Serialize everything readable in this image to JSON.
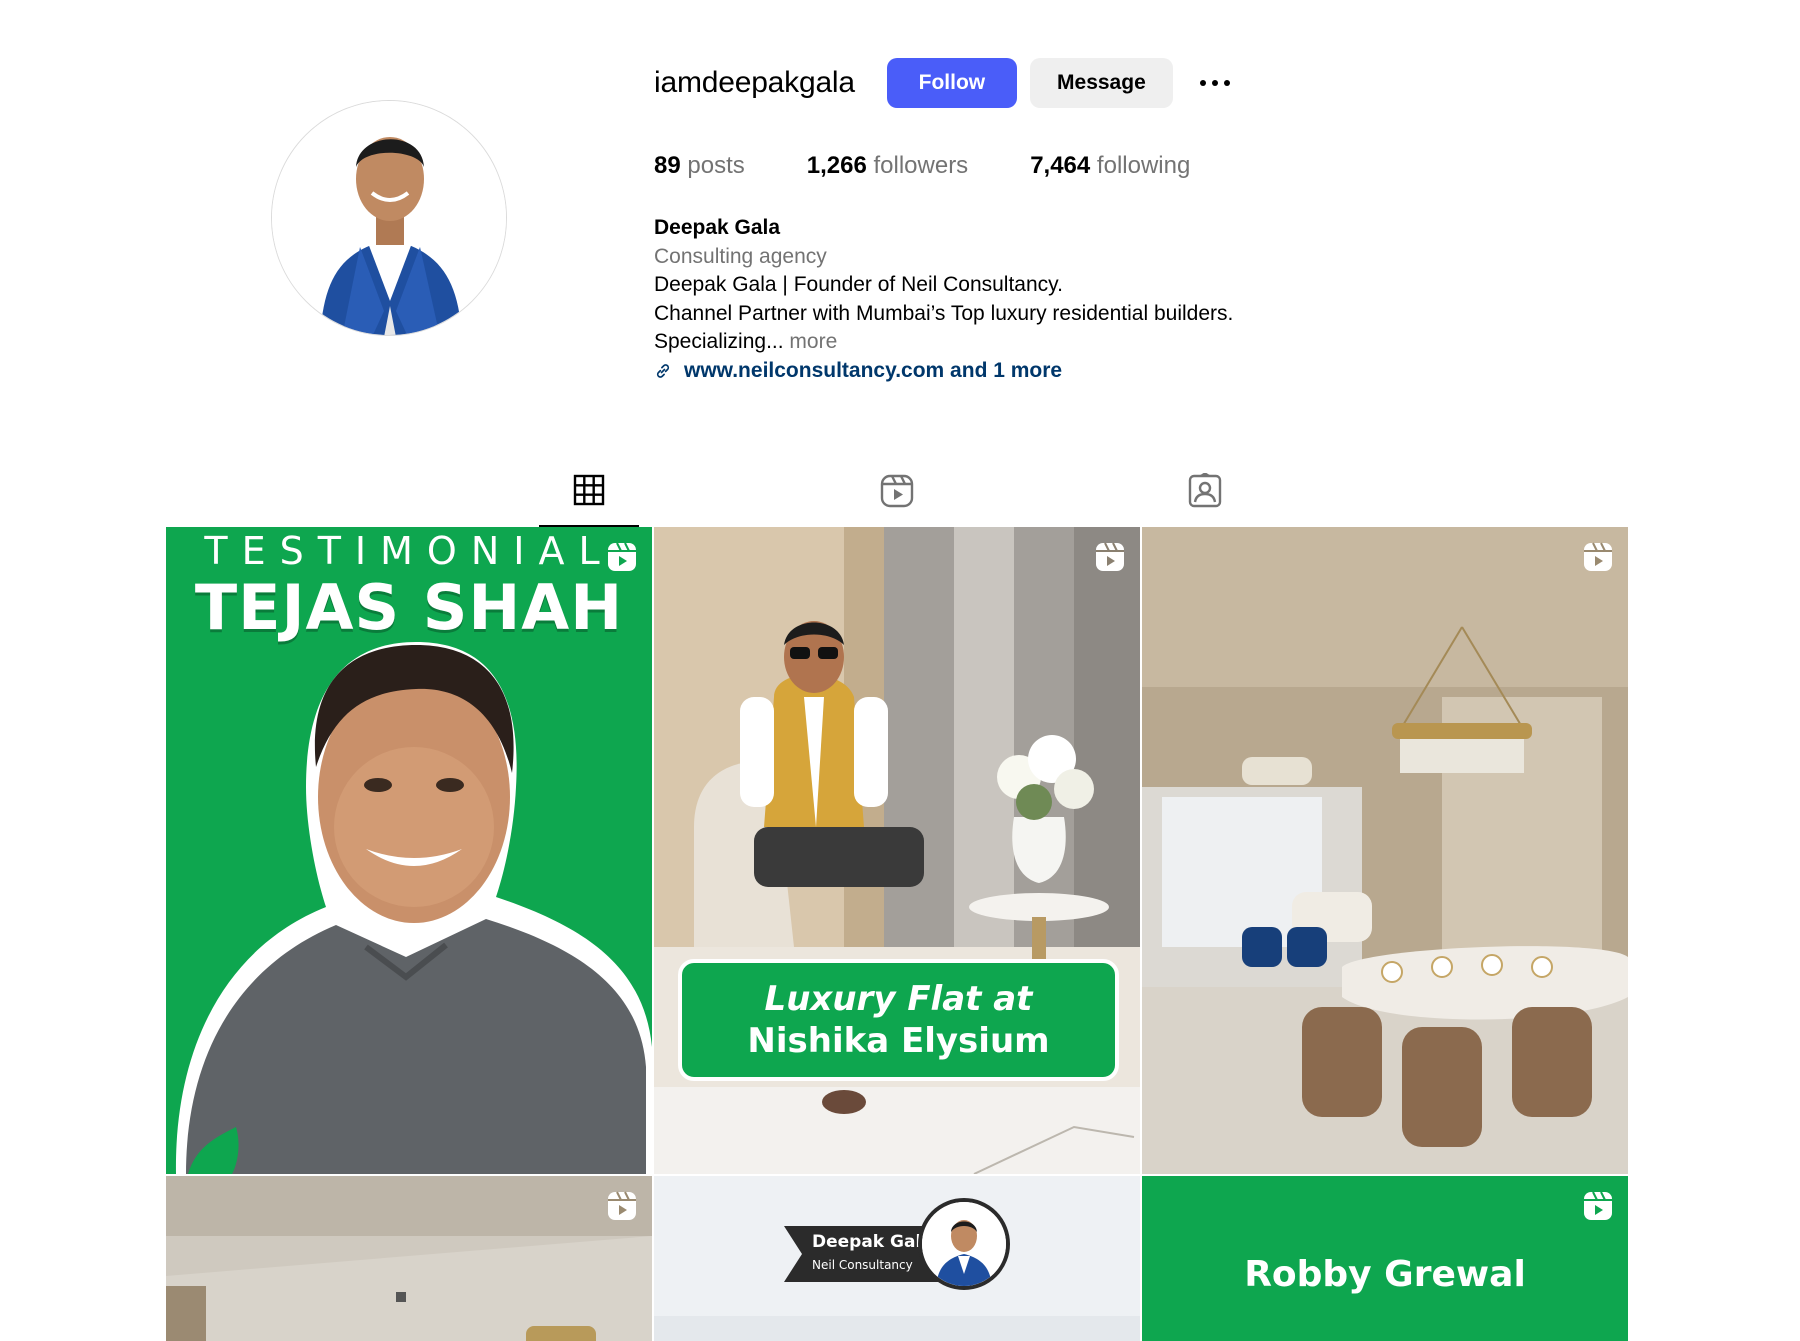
{
  "profile": {
    "username": "iamdeepakgala",
    "follow_label": "Follow",
    "message_label": "Message",
    "stats": {
      "posts_count": "89",
      "posts_label": "posts",
      "followers_count": "1,266",
      "followers_label": "followers",
      "following_count": "7,464",
      "following_label": "following"
    },
    "bio": {
      "name": "Deepak Gala",
      "category": "Consulting agency",
      "line1": "Deepak Gala | Founder of Neil Consultancy.",
      "line2": "Channel Partner with Mumbai’s Top luxury residential builders.",
      "line3": "Specializing...",
      "more_label": "more",
      "link_text": "www.neilconsultancy.com and 1 more"
    }
  },
  "tabs": [
    {
      "name": "posts",
      "icon": "grid-icon",
      "active": true
    },
    {
      "name": "reels",
      "icon": "reels-icon",
      "active": false
    },
    {
      "name": "tagged",
      "icon": "tagged-icon",
      "active": false
    }
  ],
  "posts": [
    {
      "type": "reel",
      "overlay_small": "TESTIMONIAL",
      "overlay_big": "TEJAS SHAH",
      "bg_color": "#0ea64f"
    },
    {
      "type": "reel",
      "caption_line1": "Luxury Flat at",
      "caption_line2": "Nishika Elysium",
      "bg_color": "#e9e2d8"
    },
    {
      "type": "reel",
      "bg_color": "#b9a892"
    },
    {
      "type": "reel",
      "bg_color": "#cdc7bd"
    },
    {
      "type": "post",
      "tag_name": "Deepak Gala",
      "tag_company": "Neil Consultancy",
      "bg_color": "#eef1f4"
    },
    {
      "type": "reel",
      "overlay_big": "Robby Grewal",
      "bg_color": "#0ea64f"
    }
  ],
  "colors": {
    "follow_button": "#4a5df9",
    "message_button": "#efefef",
    "link": "#00376b",
    "secondary_text": "#737373",
    "green_brand": "#0ea64f"
  }
}
